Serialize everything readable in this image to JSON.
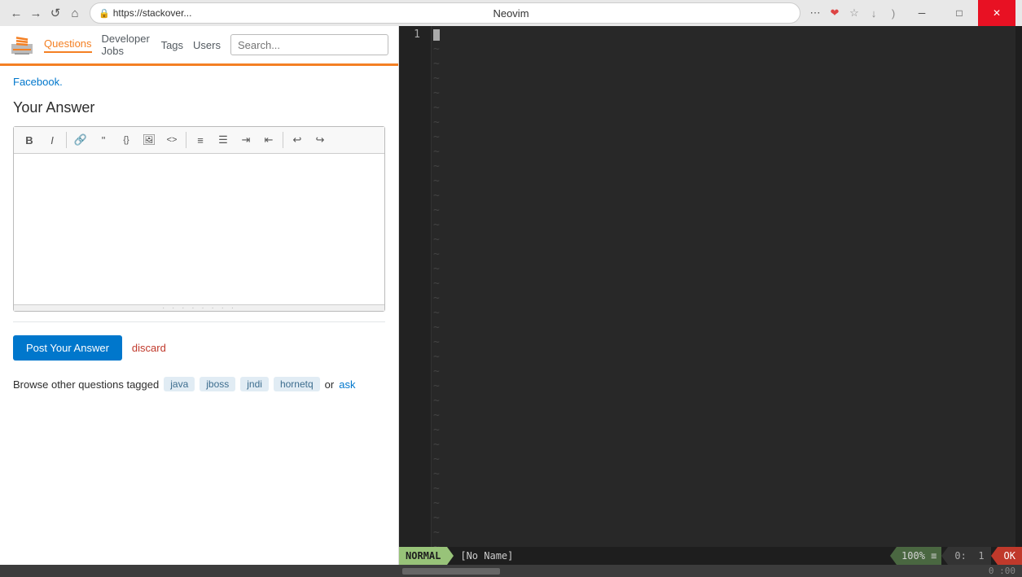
{
  "browser": {
    "address": "https://stackover...",
    "address_icon": "🔒",
    "neovim_title": "Neovim",
    "window_controls": {
      "minimize": "─",
      "maximize": "□",
      "close": "✕"
    }
  },
  "stackoverflow": {
    "logo_text": "stack overflow",
    "nav": {
      "questions": "Questions",
      "developer_jobs": "Developer Jobs",
      "tags": "Tags",
      "users": "Users"
    },
    "search_placeholder": "Search...",
    "facebook_link": "Facebook.",
    "your_answer_heading": "Your Answer",
    "toolbar": {
      "bold": "B",
      "italic": "I",
      "link": "🔗",
      "blockquote": "❝",
      "code_inline": "{}",
      "image": "🖼",
      "html": "⟨⟩",
      "ordered_list": "≡",
      "unordered_list": "☰",
      "indent": "⇥",
      "outdent": "⇤",
      "undo": "↩",
      "redo": "↪"
    },
    "post_answer_btn": "Post Your Answer",
    "discard_link": "discard",
    "browse_text": "Browse other questions tagged",
    "tags": [
      "java",
      "jboss",
      "jndi",
      "hornetq"
    ],
    "browse_or": "or",
    "ask_link": "ask"
  },
  "neovim": {
    "title": "Neovim",
    "status_mode": "NORMAL",
    "filename": "[No Name]",
    "percent": "100%",
    "lines_icon": "≡",
    "position": "0:",
    "line_num": "1",
    "status_ok": "OK",
    "tilde": "~"
  }
}
